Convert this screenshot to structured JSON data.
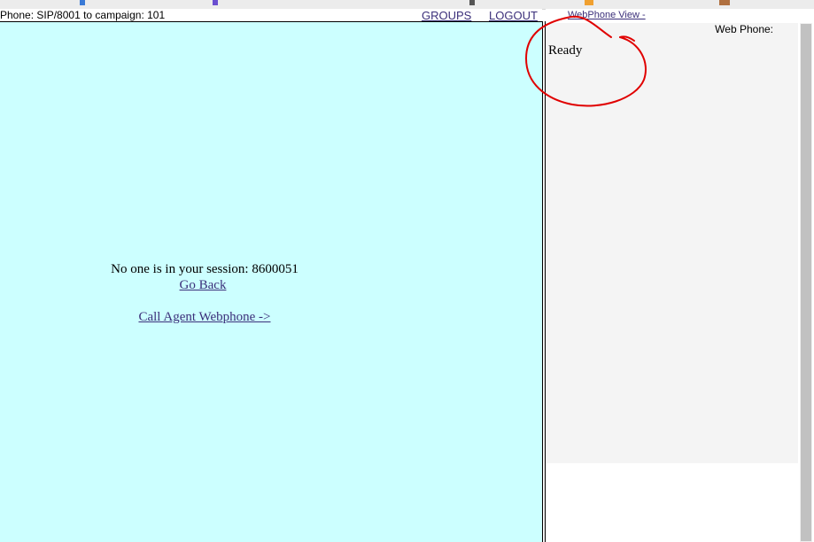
{
  "header": {
    "phone_info": "Phone: SIP/8001  to campaign: 101",
    "groups_label": "GROUPS",
    "logout_label": "LOGOUT"
  },
  "session": {
    "message": "No one is in your session: 8600051",
    "go_back_label": "Go Back",
    "call_webphone_label": "Call Agent Webphone ->"
  },
  "webphone": {
    "view_link_label": "WebPhone View -",
    "label": "Web Phone:",
    "status": "Ready"
  },
  "colors": {
    "session_bg": "#ccffff",
    "link": "#3b2f7a",
    "annotation": "#e00000"
  }
}
